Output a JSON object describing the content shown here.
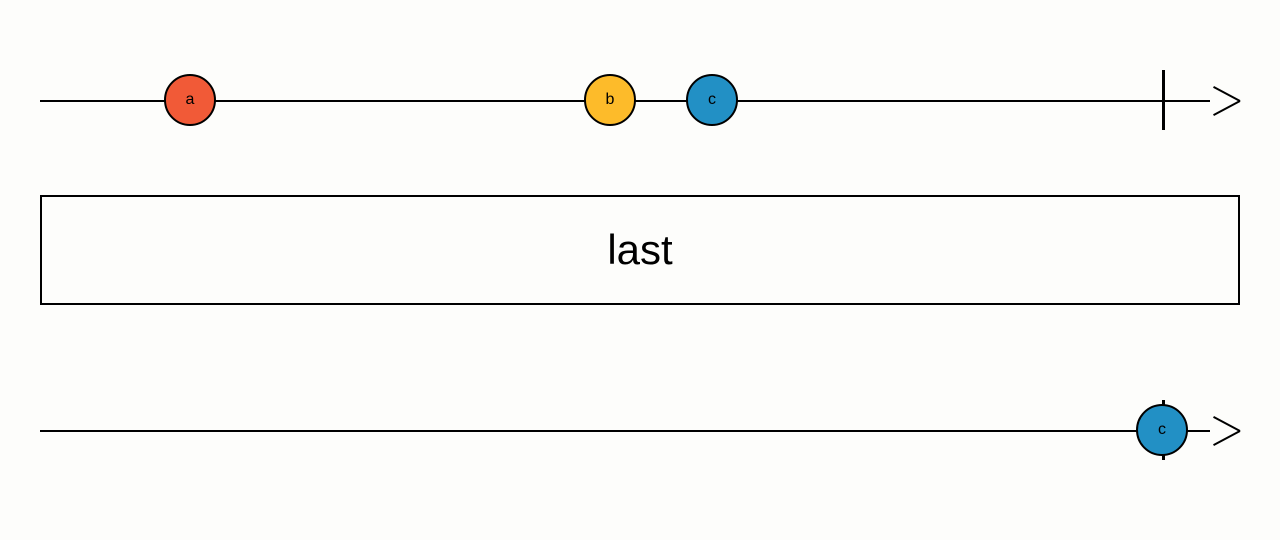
{
  "chart_data": {
    "type": "marble-diagram",
    "operator": "last",
    "input_stream": {
      "events": [
        {
          "label": "a",
          "position": 0.125,
          "color": "#f15a37"
        },
        {
          "label": "b",
          "position": 0.475,
          "color": "#fdbb2a"
        },
        {
          "label": "c",
          "position": 0.56,
          "color": "#2290c5"
        }
      ],
      "completion_position": 0.935
    },
    "output_stream": {
      "events": [
        {
          "label": "c",
          "position": 0.935,
          "color": "#2290c5"
        }
      ],
      "completion_position": 0.935
    }
  },
  "operator_label": "last",
  "marbles": {
    "in_a": "a",
    "in_b": "b",
    "in_c": "c",
    "out_c": "c"
  },
  "colors": {
    "a": "#f15a37",
    "b": "#fdbb2a",
    "c": "#2290c5"
  }
}
